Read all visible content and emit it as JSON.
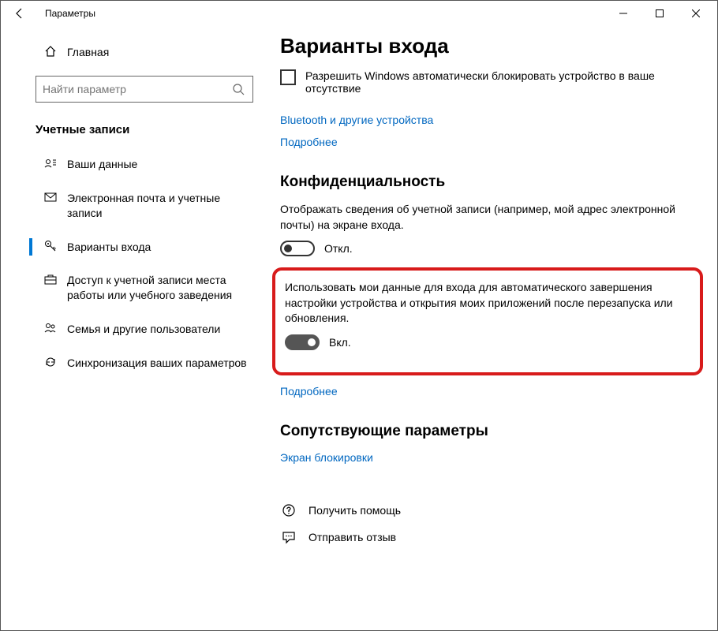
{
  "window": {
    "title": "Параметры"
  },
  "sidebar": {
    "home": "Главная",
    "search_placeholder": "Найти параметр",
    "category": "Учетные записи",
    "items": [
      {
        "label": "Ваши данные"
      },
      {
        "label": "Электронная почта и учетные записи"
      },
      {
        "label": "Варианты входа"
      },
      {
        "label": "Доступ к учетной записи места работы или учебного заведения"
      },
      {
        "label": "Семья и другие пользователи"
      },
      {
        "label": "Синхронизация ваших параметров"
      }
    ]
  },
  "content": {
    "title": "Варианты входа",
    "checkbox_label": "Разрешить Windows автоматически блокировать устройство в ваше отсутствие",
    "bt_link": "Bluetooth и другие устройства",
    "more": "Подробнее",
    "privacy_heading": "Конфиденциальность",
    "privacy_desc": "Отображать сведения об учетной записи (например, мой адрес электронной почты) на экране входа.",
    "off_label": "Откл.",
    "highlight_desc": "Использовать мои данные для входа для автоматического завершения настройки устройства и открытия моих приложений после перезапуска или обновления.",
    "on_label": "Вкл.",
    "more2": "Подробнее",
    "related_heading": "Сопутствующие параметры",
    "lockscreen": "Экран блокировки",
    "help": "Получить помощь",
    "feedback": "Отправить отзыв"
  }
}
